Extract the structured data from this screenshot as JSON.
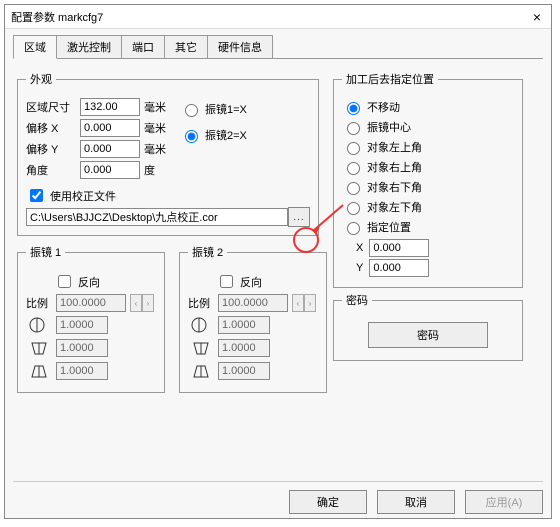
{
  "window": {
    "title": "配置参数 markcfg7",
    "close": "×"
  },
  "tabs": {
    "items": [
      "区域",
      "激光控制",
      "端口",
      "其它",
      "硬件信息"
    ],
    "active": 0
  },
  "appearance": {
    "legend": "外观",
    "area_size_label": "区域尺寸",
    "area_size_value": "132.00",
    "unit_mm": "毫米",
    "unit_deg": "度",
    "offset_x_label": "偏移 X",
    "offset_x_value": "0.000",
    "offset_y_label": "偏移 Y",
    "offset_y_value": "0.000",
    "angle_label": "角度",
    "angle_value": "0.000",
    "mirror1_label": "振镜1=X",
    "mirror2_label": "振镜2=X",
    "mirror_selected": "mirror2",
    "use_file_label": "使用校正文件",
    "use_file_checked": true,
    "file_path": "C:\\Users\\BJJCZ\\Desktop\\九点校正.cor",
    "browse_label": "..."
  },
  "galvo": {
    "legend1": "振镜 1",
    "legend2": "振镜 2",
    "reverse_label": "反向",
    "ratio_label": "比例",
    "ratio_value": "100.0000",
    "coef_value": "1.0000"
  },
  "postpos": {
    "legend": "加工后去指定位置",
    "options": [
      "不移动",
      "振镜中心",
      "对象左上角",
      "对象右上角",
      "对象右下角",
      "对象左下角",
      "指定位置"
    ],
    "selected": 0,
    "x_label": "X",
    "y_label": "Y",
    "x_value": "0.000",
    "y_value": "0.000"
  },
  "password": {
    "legend": "密码",
    "button": "密码"
  },
  "buttons": {
    "ok": "确定",
    "cancel": "取消",
    "apply": "应用(A)"
  }
}
